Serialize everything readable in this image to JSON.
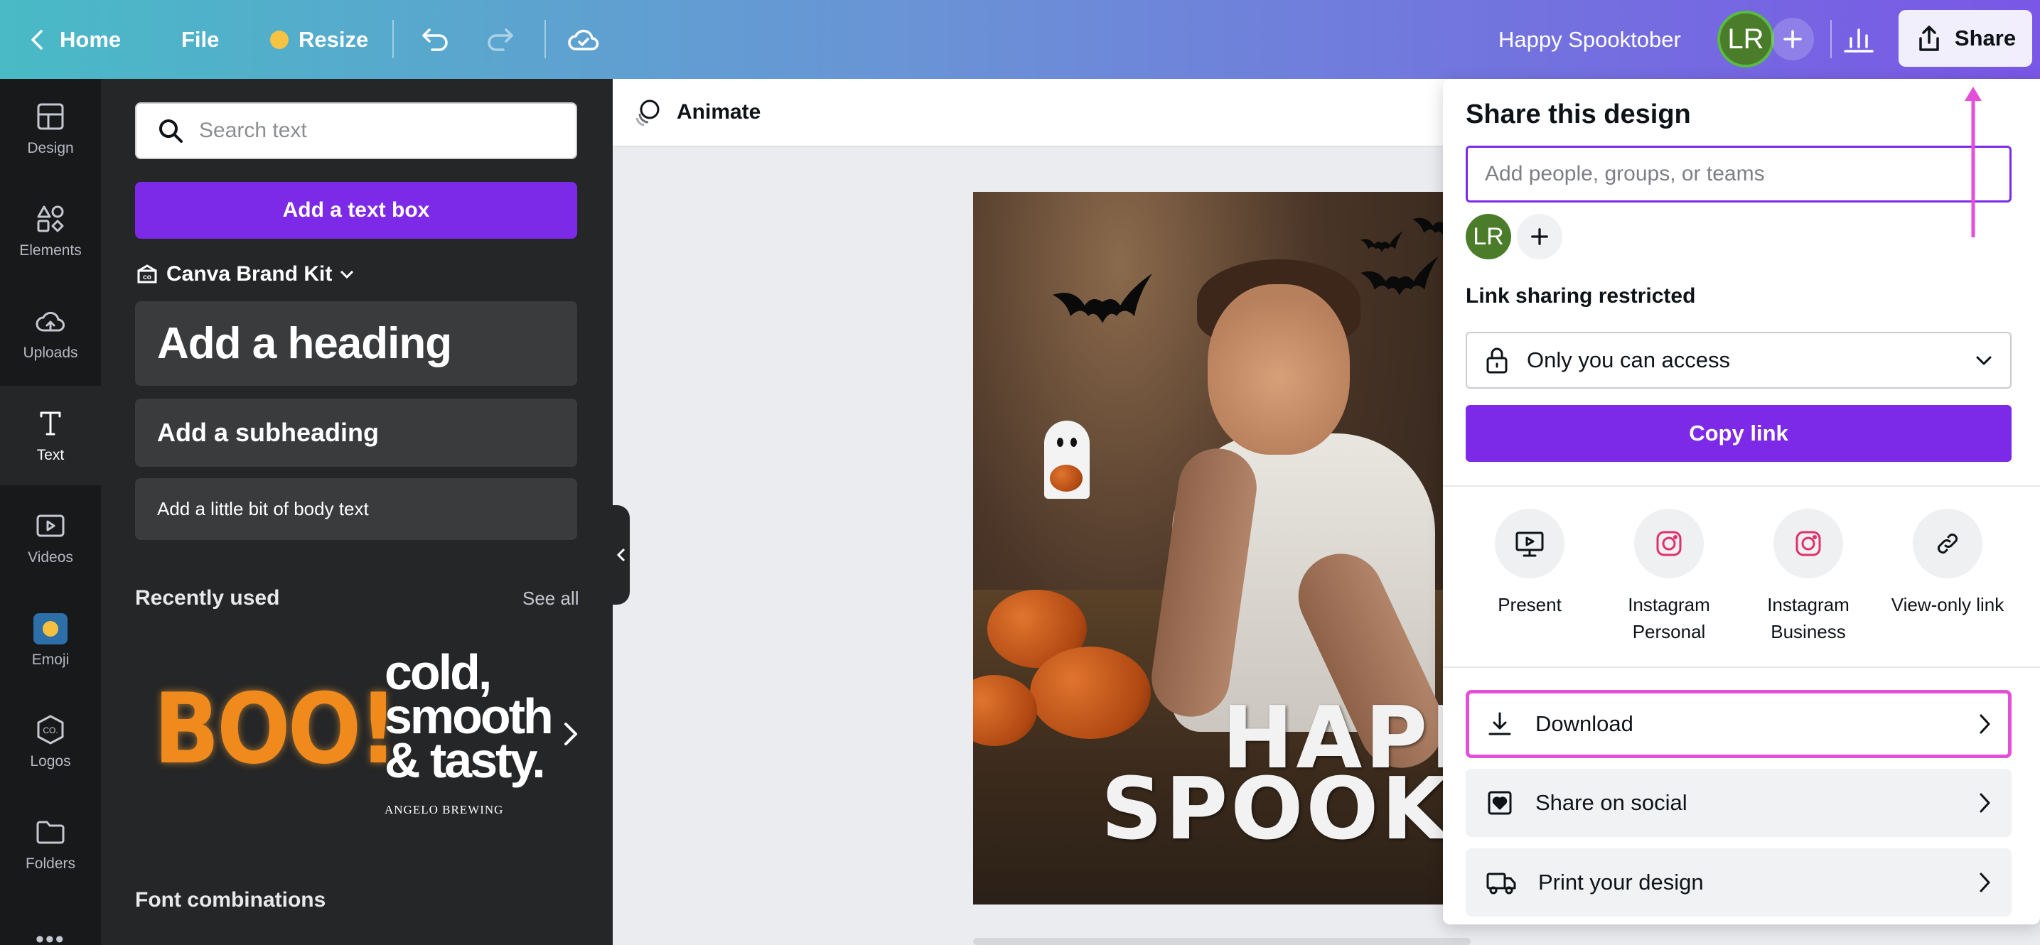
{
  "topbar": {
    "home_label": "Home",
    "file_label": "File",
    "resize_label": "Resize",
    "design_title": "Happy Spooktober",
    "avatar_initials": "LR",
    "share_label": "Share",
    "gradient": [
      "#49bac6",
      "#7a57e6"
    ]
  },
  "rail": {
    "items": [
      {
        "label": "Design",
        "icon": "layout-icon"
      },
      {
        "label": "Elements",
        "icon": "shapes-icon"
      },
      {
        "label": "Uploads",
        "icon": "cloud-upload-icon"
      },
      {
        "label": "Text",
        "icon": "text-icon"
      },
      {
        "label": "Videos",
        "icon": "video-icon"
      },
      {
        "label": "Emoji",
        "icon": "emoji-icon"
      },
      {
        "label": "Logos",
        "icon": "logo-icon"
      },
      {
        "label": "Folders",
        "icon": "folder-icon"
      }
    ],
    "active": "Text"
  },
  "panel": {
    "search_placeholder": "Search text",
    "add_text_box": "Add a text box",
    "brand_kit": "Canva Brand Kit",
    "heading": "Add a heading",
    "subheading": "Add a subheading",
    "body": "Add a little bit of body text",
    "recently_used": "Recently used",
    "see_all": "See all",
    "recent": {
      "boo": "BOO!",
      "cold_lines": [
        "cold,",
        "smooth",
        "& tasty."
      ],
      "angelo": "ANGELO BREWING"
    },
    "font_combinations": "Font combinations",
    "accent": "#7d2ae8"
  },
  "canvas": {
    "animate_label": "Animate",
    "design_text_line1": "HAPPY",
    "design_text_line2": "SPOOKTOB"
  },
  "share": {
    "title": "Share this design",
    "input_placeholder": "Add people, groups, or teams",
    "avatar_initials": "LR",
    "link_sharing_label": "Link sharing restricted",
    "access_value": "Only you can access",
    "copy_link": "Copy link",
    "options": [
      {
        "label": "Present",
        "icon": "present-icon"
      },
      {
        "label": "Instagram Personal",
        "icon": "instagram-icon"
      },
      {
        "label": "Instagram Business",
        "icon": "instagram-icon"
      },
      {
        "label": "View-only link",
        "icon": "link-icon"
      }
    ],
    "actions": [
      {
        "label": "Download",
        "icon": "download-icon",
        "highlighted": true
      },
      {
        "label": "Share on social",
        "icon": "social-heart-icon",
        "highlighted": false
      },
      {
        "label": "Print your design",
        "icon": "truck-icon",
        "highlighted": false
      }
    ],
    "highlight_color": "#e44fd8"
  }
}
